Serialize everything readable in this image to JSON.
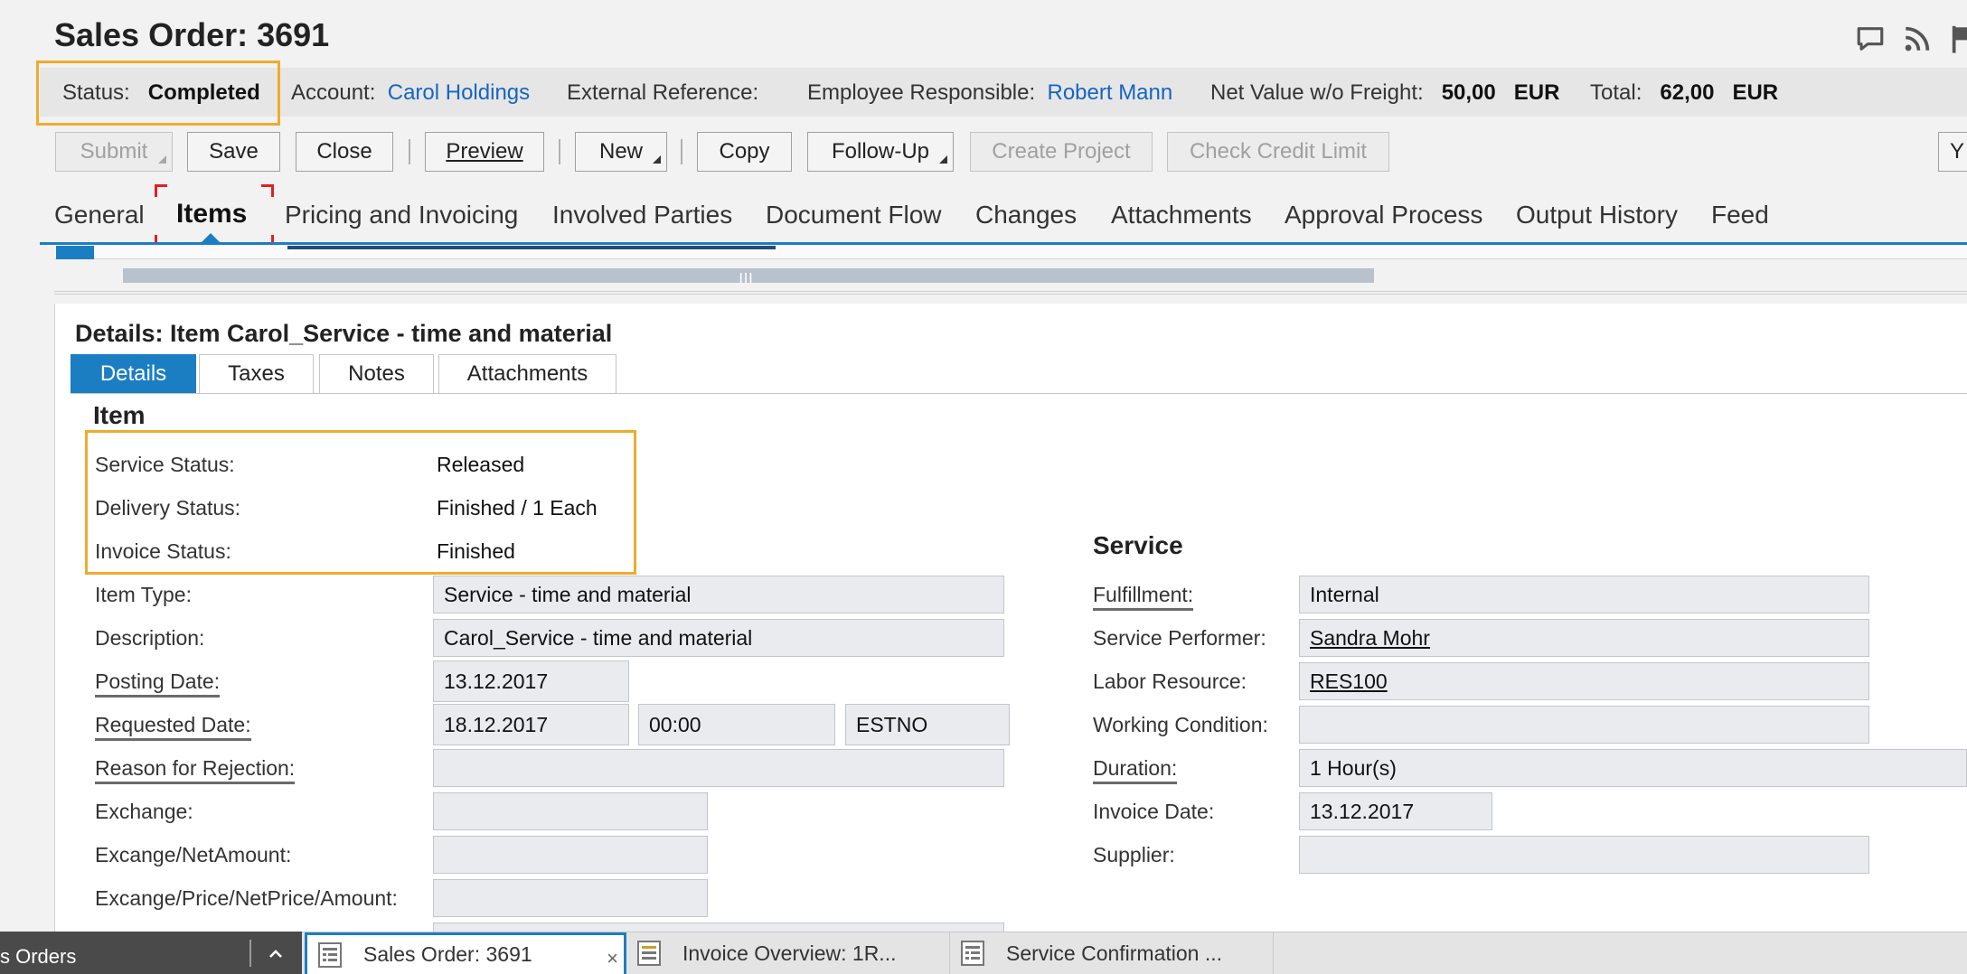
{
  "header": {
    "title": "Sales Order: 3691",
    "status_label": "Status:",
    "status_value": "Completed",
    "account_label": "Account:",
    "account_value": "Carol Holdings",
    "ext_ref_label": "External Reference:",
    "employee_label": "Employee Responsible:",
    "employee_value": "Robert Mann",
    "net_label": "Net Value w/o Freight:",
    "net_value": "50,00",
    "net_currency": "EUR",
    "total_label": "Total:",
    "total_value": "62,00",
    "total_currency": "EUR"
  },
  "toolbar": {
    "submit": "Submit",
    "save": "Save",
    "close": "Close",
    "preview": "Preview",
    "new": "New",
    "copy": "Copy",
    "followup": "Follow-Up",
    "create_project": "Create Project",
    "check_credit": "Check Credit Limit",
    "overflow": "Y"
  },
  "tabs": [
    "General",
    "Items",
    "Pricing and Invoicing",
    "Involved Parties",
    "Document Flow",
    "Changes",
    "Attachments",
    "Approval Process",
    "Output History",
    "Feed"
  ],
  "details": {
    "title": "Details: Item Carol_Service - time and material",
    "subtabs": [
      "Details",
      "Taxes",
      "Notes",
      "Attachments"
    ],
    "item_section": "Item",
    "service_status_label": "Service Status:",
    "service_status_value": "Released",
    "delivery_status_label": "Delivery Status:",
    "delivery_status_value": "Finished / 1 Each",
    "invoice_status_label": "Invoice Status:",
    "invoice_status_value": "Finished",
    "item_type_label": "Item Type:",
    "item_type_value": "Service - time and material",
    "description_label": "Description:",
    "description_value": "Carol_Service - time and material",
    "posting_date_label": "Posting Date:",
    "posting_date_value": "13.12.2017",
    "requested_date_label": "Requested Date:",
    "requested_date_value": "18.12.2017",
    "requested_time_value": "00:00",
    "requested_tz_value": "ESTNO",
    "rejection_label": "Reason for Rejection:",
    "rejection_value": "",
    "exchange_label": "Exchange:",
    "exchange_value": "",
    "exchange_net_label": "Excange/NetAmount:",
    "exchange_net_value": "",
    "exchange_price_label": "Excange/Price/NetPrice/Amount:",
    "exchange_price_value": "",
    "service_section": "Service",
    "fulfillment_label": "Fulfillment:",
    "fulfillment_value": "Internal",
    "performer_label": "Service Performer:",
    "performer_value": "Sandra Mohr",
    "labor_label": "Labor Resource:",
    "labor_value": "RES100",
    "working_label": "Working Condition:",
    "working_value": "",
    "duration_label": "Duration:",
    "duration_value": "1 Hour(s)",
    "invoice_date_label": "Invoice Date:",
    "invoice_date_value": "13.12.2017",
    "supplier_label": "Supplier:",
    "supplier_value": ""
  },
  "taskbar": {
    "left_label": "s Orders",
    "tabs": [
      "Sales Order: 3691",
      "Invoice Overview: 1R...",
      "Service Confirmation ..."
    ],
    "close_glyph": "×"
  },
  "icons": {
    "title_bar": [
      "comment-icon",
      "rss-icon",
      "flag-icon"
    ],
    "taskbar_tab": "document-icon"
  },
  "colors": {
    "accent": "#1c7ec2",
    "link": "#1565c0",
    "highlight": "#f0ab2d",
    "marker": "#e02020"
  }
}
